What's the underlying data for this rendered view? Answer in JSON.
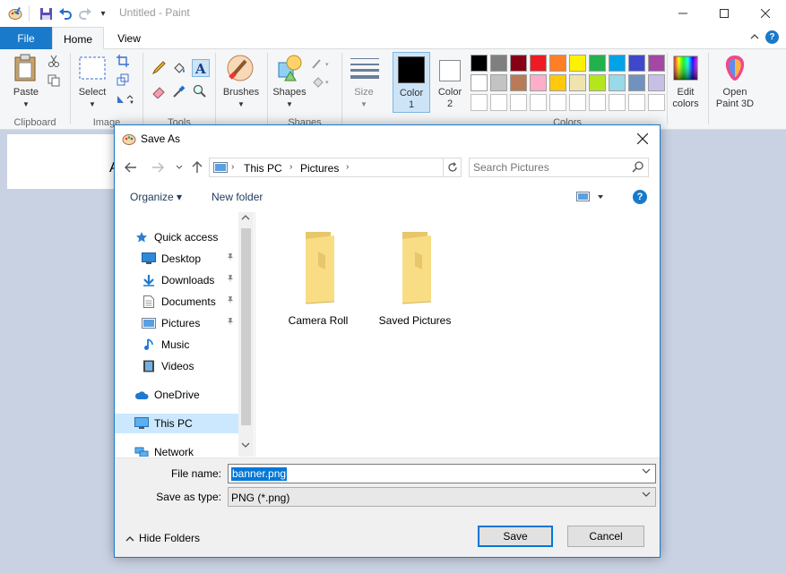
{
  "app": {
    "title": "Untitled - Paint",
    "tabs": {
      "file": "File",
      "home": "Home",
      "view": "View"
    },
    "help_glyph": "?"
  },
  "ribbon": {
    "clipboard": {
      "label": "Clipboard",
      "paste": "Paste"
    },
    "image": {
      "label": "Image",
      "select": "Select"
    },
    "tools": {
      "label": "Tools"
    },
    "brushes": {
      "label": "Brushes"
    },
    "shapes": {
      "label": "Shapes"
    },
    "size": {
      "label": "Size"
    },
    "color1": {
      "line1": "Color",
      "line2": "1"
    },
    "color2": {
      "line1": "Color",
      "line2": "2"
    },
    "colors": {
      "label": "Colors"
    },
    "edit_colors": {
      "line1": "Edit",
      "line2": "colors"
    },
    "open_paint3d": {
      "line1": "Open",
      "line2": "Paint 3D"
    },
    "palette_row1": [
      "#000000",
      "#7f7f7f",
      "#880015",
      "#ed1c24",
      "#ff7f27",
      "#fff200",
      "#22b14c",
      "#00a2e8",
      "#3f48cc",
      "#a349a4"
    ],
    "palette_row2": [
      "#ffffff",
      "#c3c3c3",
      "#b97a57",
      "#ffaec9",
      "#ffc90e",
      "#efe4b0",
      "#b5e61d",
      "#99d9ea",
      "#7092be",
      "#c8bfe7"
    ],
    "primary_color": "#000000",
    "secondary_color": "#ffffff"
  },
  "canvas": {
    "text": "A"
  },
  "dialog": {
    "title": "Save As",
    "close_glyph": "✕",
    "address": {
      "crumbs": [
        "This PC",
        "Pictures"
      ]
    },
    "search_placeholder": "Search Pictures",
    "organize": "Organize ▾",
    "new_folder": "New folder",
    "help_glyph": "?",
    "nav": {
      "quick_access": "Quick access",
      "items": [
        {
          "label": "Desktop",
          "pinned": true
        },
        {
          "label": "Downloads",
          "pinned": true
        },
        {
          "label": "Documents",
          "pinned": true
        },
        {
          "label": "Pictures",
          "pinned": true
        },
        {
          "label": "Music",
          "pinned": false
        },
        {
          "label": "Videos",
          "pinned": false
        }
      ],
      "onedrive": "OneDrive",
      "this_pc": "This PC",
      "network": "Network"
    },
    "folders": [
      "Camera Roll",
      "Saved Pictures"
    ],
    "file_name_label": "File name:",
    "file_name_value": "banner.png",
    "save_type_label": "Save as type:",
    "save_type_value": "PNG (*.png)",
    "hide_folders": "Hide Folders",
    "save_button": "Save",
    "cancel_button": "Cancel"
  }
}
